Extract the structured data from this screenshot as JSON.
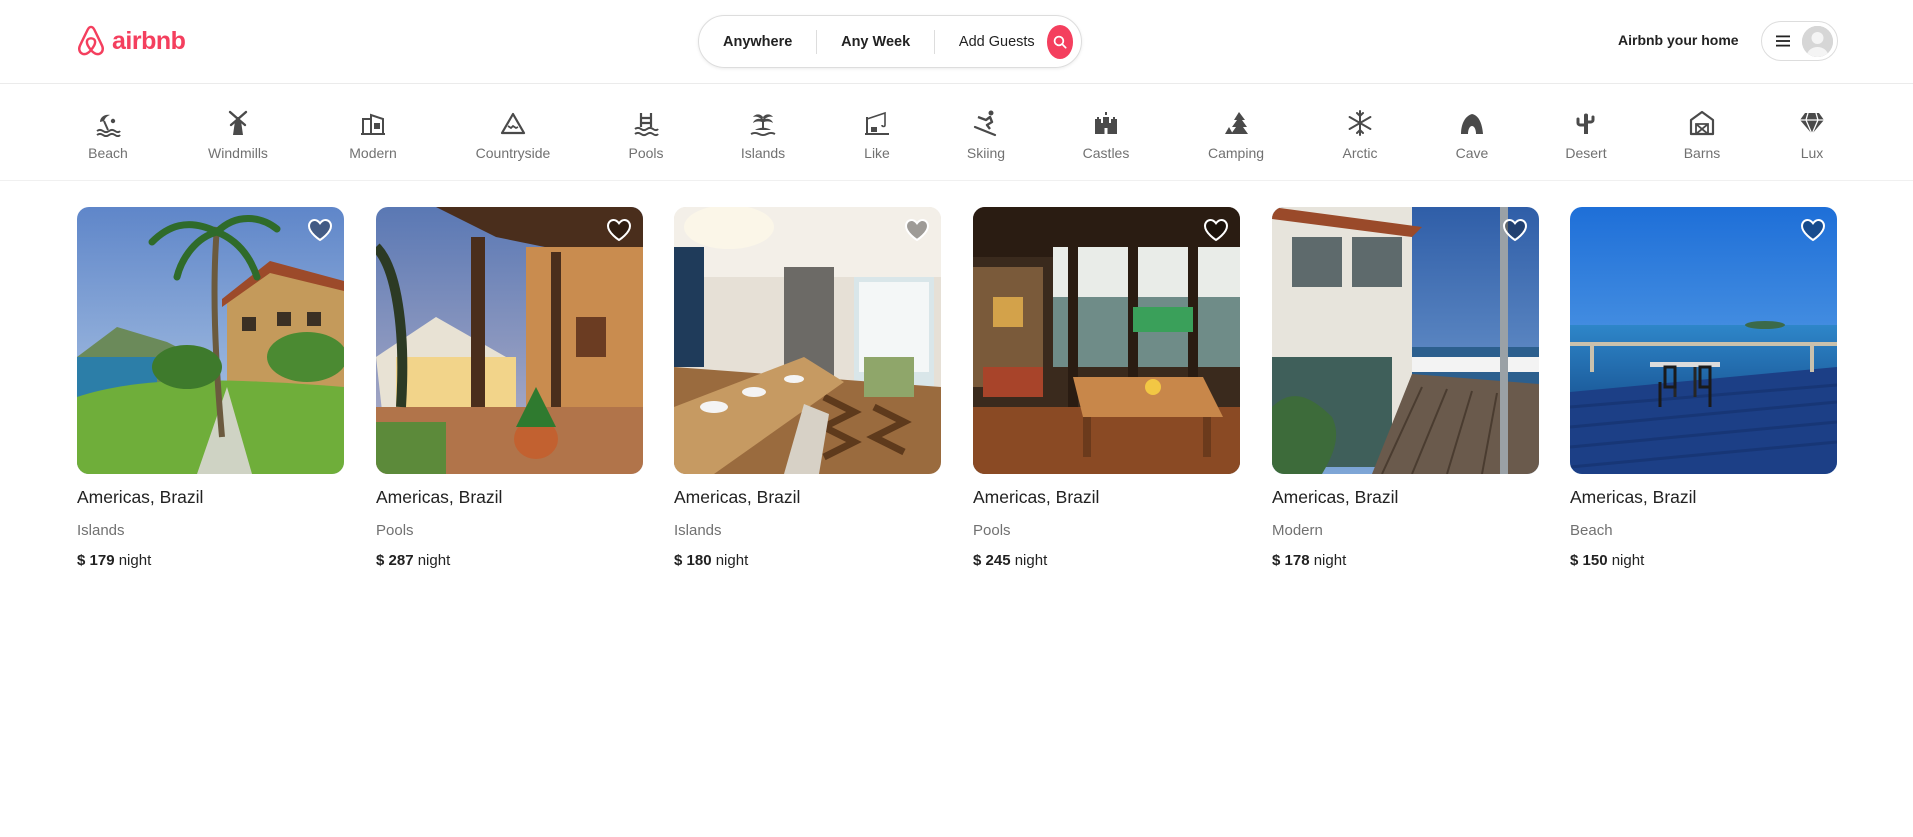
{
  "brand": {
    "name": "airbnb",
    "color": "#F43F5E"
  },
  "search": {
    "where": "Anywhere",
    "when": "Any Week",
    "who": "Add Guests",
    "button_icon": "search-icon"
  },
  "header": {
    "host_link": "Airbnb your home",
    "menu_icon": "hamburger-icon",
    "avatar_icon": "user-avatar-icon"
  },
  "categories": [
    {
      "label": "Beach",
      "icon": "beach-icon"
    },
    {
      "label": "Windmills",
      "icon": "windmill-icon"
    },
    {
      "label": "Modern",
      "icon": "modern-building-icon"
    },
    {
      "label": "Countryside",
      "icon": "mountain-icon"
    },
    {
      "label": "Pools",
      "icon": "pool-icon"
    },
    {
      "label": "Islands",
      "icon": "island-icon"
    },
    {
      "label": "Like",
      "icon": "fishing-icon"
    },
    {
      "label": "Skiing",
      "icon": "skiing-icon"
    },
    {
      "label": "Castles",
      "icon": "castle-icon"
    },
    {
      "label": "Camping",
      "icon": "camping-icon"
    },
    {
      "label": "Arctic",
      "icon": "snowflake-icon"
    },
    {
      "label": "Cave",
      "icon": "cave-icon"
    },
    {
      "label": "Desert",
      "icon": "cactus-icon"
    },
    {
      "label": "Barns",
      "icon": "barn-icon"
    },
    {
      "label": "Lux",
      "icon": "diamond-icon"
    }
  ],
  "listings": [
    {
      "location": "Americas, Brazil",
      "category": "Islands",
      "currency": "$",
      "price": "179",
      "unit": "night"
    },
    {
      "location": "Americas, Brazil",
      "category": "Pools",
      "currency": "$",
      "price": "287",
      "unit": "night"
    },
    {
      "location": "Americas, Brazil",
      "category": "Islands",
      "currency": "$",
      "price": "180",
      "unit": "night"
    },
    {
      "location": "Americas, Brazil",
      "category": "Pools",
      "currency": "$",
      "price": "245",
      "unit": "night"
    },
    {
      "location": "Americas, Brazil",
      "category": "Modern",
      "currency": "$",
      "price": "178",
      "unit": "night"
    },
    {
      "location": "Americas, Brazil",
      "category": "Beach",
      "currency": "$",
      "price": "150",
      "unit": "night"
    }
  ]
}
